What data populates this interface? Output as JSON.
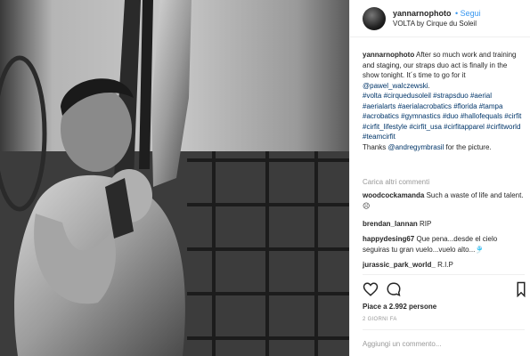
{
  "header": {
    "username": "yannarnophoto",
    "follow_label": "• Segui",
    "location": "VOLTA by Cirque du Soleil"
  },
  "caption": {
    "username": "yannarnophoto",
    "text_prefix": "After so much work and training and staging, our straps duo act is finally in the show tonight. It´s time to go for it ",
    "mention": "@pawel_walczewski",
    "text_suffix": ".",
    "hashtags": "#volta #cirquedusoleil #strapsduo #aerial #aerialarts #aerialacrobatics #florida #tampa #acrobatics #gymnastics #duo #hallofequals #cirfit #cirfit_lifestyle #cirfit_usa #cirfitapparel #cirfitworld #teamcirfit",
    "thanks_prefix": "Thanks ",
    "thanks_mention": "@andregymbrasil",
    "thanks_suffix": " for the picture."
  },
  "load_more": "Carica altri commenti",
  "comments": [
    {
      "user": "woodcockamanda",
      "text": "Such a waste of life and talent. ☹"
    },
    {
      "user": "brendan_lannan",
      "text": "RIP"
    },
    {
      "user": "happydesing67",
      "text": "Que pena...desde el cielo seguiras tu gran vuelo...vuelo alto...🎐"
    },
    {
      "user": "jurassic_park_world_",
      "text": "R.I.P"
    }
  ],
  "actions": {
    "like_icon": "heart-icon",
    "comment_icon": "speech-bubble-icon",
    "bookmark_icon": "bookmark-icon"
  },
  "likes": "Piace a 2.992 persone",
  "time_ago": "2 GIORNI FA",
  "add_comment_placeholder": "Aggiungi un commento..."
}
